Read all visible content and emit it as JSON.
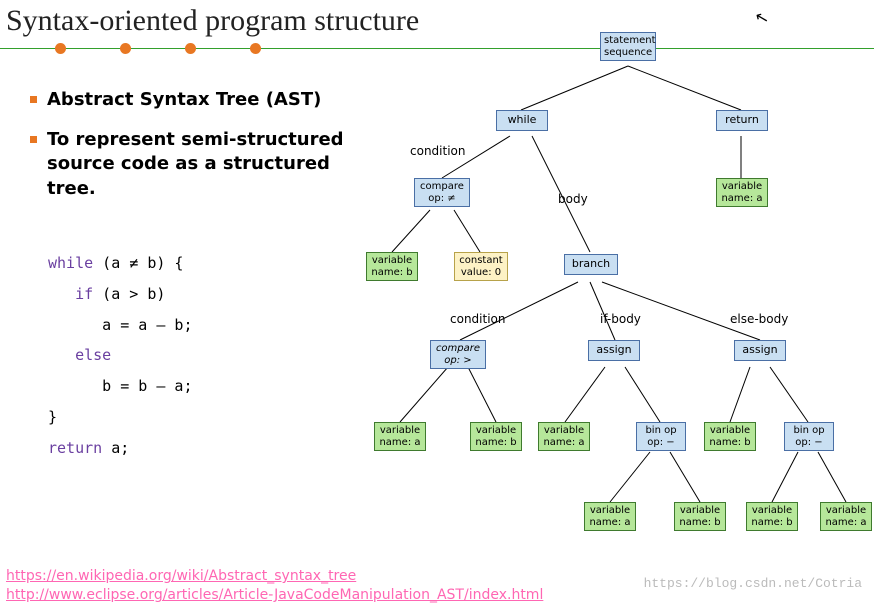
{
  "title": "Syntax-oriented program structure",
  "bullets": {
    "b1": "Abstract Syntax Tree (AST)",
    "b2": "To represent semi-structured source code as a structured tree."
  },
  "code": {
    "l1a": "while",
    "l1b": " (a ≠ b) {",
    "l2a": "   if",
    "l2b": " (a > b)",
    "l3": "      a = a – b;",
    "l4": "   else",
    "l5": "      b = b – a;",
    "l6": "}",
    "l7a": "return",
    "l7b": " a;"
  },
  "links": {
    "u1": "https://en.wikipedia.org/wiki/Abstract_syntax_tree",
    "u2": "http://www.eclipse.org/articles/Article-JavaCodeManipulation_AST/index.html"
  },
  "watermark": "https://blog.csdn.net/Cotria",
  "edge_labels": {
    "cond1": "condition",
    "body": "body",
    "cond2": "condition",
    "ifb": "if-body",
    "elb": "else-body"
  },
  "nodes": {
    "root": "statement\nsequence",
    "while": "while",
    "return": "return",
    "ret_var": "variable\nname: a",
    "cmp1": "compare\nop: ≠",
    "var_b1": "variable\nname: b",
    "const0": "constant\nvalue: 0",
    "branch": "branch",
    "cmp2": "compare\nop: >",
    "cmp2_a": "variable\nname: a",
    "cmp2_b": "variable\nname: b",
    "asg1": "assign",
    "asg1_a": "variable\nname: a",
    "asg1_op": "bin op\nop: −",
    "asg1_op_a": "variable\nname: a",
    "asg1_op_b": "variable\nname: b",
    "asg2": "assign",
    "asg2_b": "variable\nname: b",
    "asg2_op": "bin op\nop: −",
    "asg2_op_b": "variable\nname: b",
    "asg2_op_a": "variable\nname: a"
  }
}
